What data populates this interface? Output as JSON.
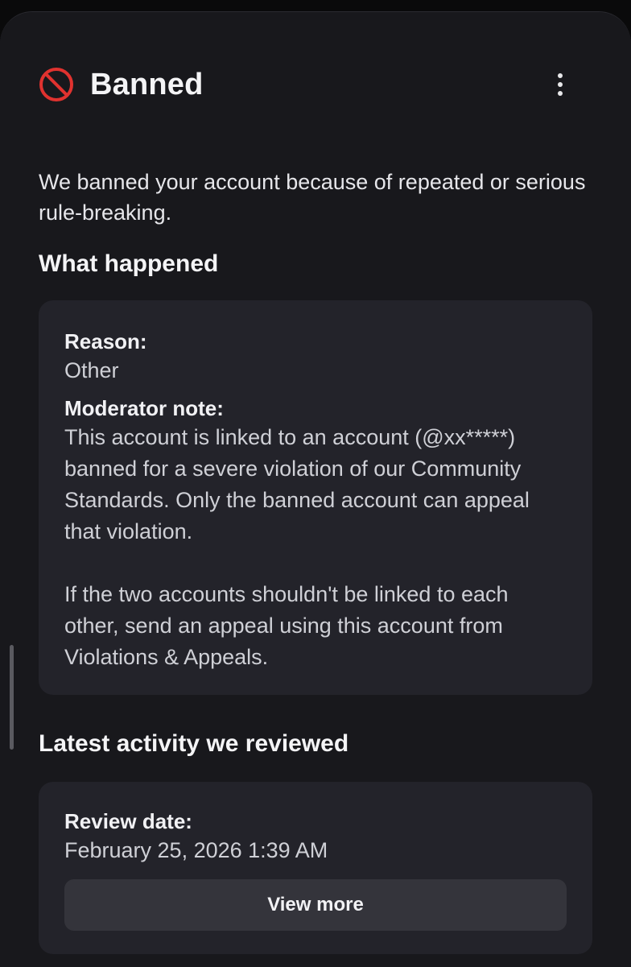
{
  "header": {
    "title": "Banned",
    "icon": "ban-icon",
    "icon_color": "#e0322f",
    "menu_icon": "more-vertical-icon"
  },
  "intro_text": "We banned your account because of repeated or serious rule-breaking.",
  "what_happened": {
    "heading": "What happened",
    "reason_label": "Reason:",
    "reason_value": "Other",
    "note_label": "Moderator note:",
    "note_paragraphs": [
      "This account is linked to an account (@xx*****) banned for a severe violation of our Community Standards. Only the banned account can appeal that violation.",
      "If the two accounts shouldn't be linked to each other, send an appeal using this account from Violations & Appeals."
    ]
  },
  "latest_activity": {
    "heading": "Latest activity we reviewed",
    "review_date_label": "Review date:",
    "review_date_value": "February 25, 2026 1:39 AM",
    "view_more_label": "View more"
  },
  "colors": {
    "sheet_bg": "#18181c",
    "card_bg": "#23232a",
    "button_bg": "#34343b",
    "accent_red": "#e0322f"
  }
}
